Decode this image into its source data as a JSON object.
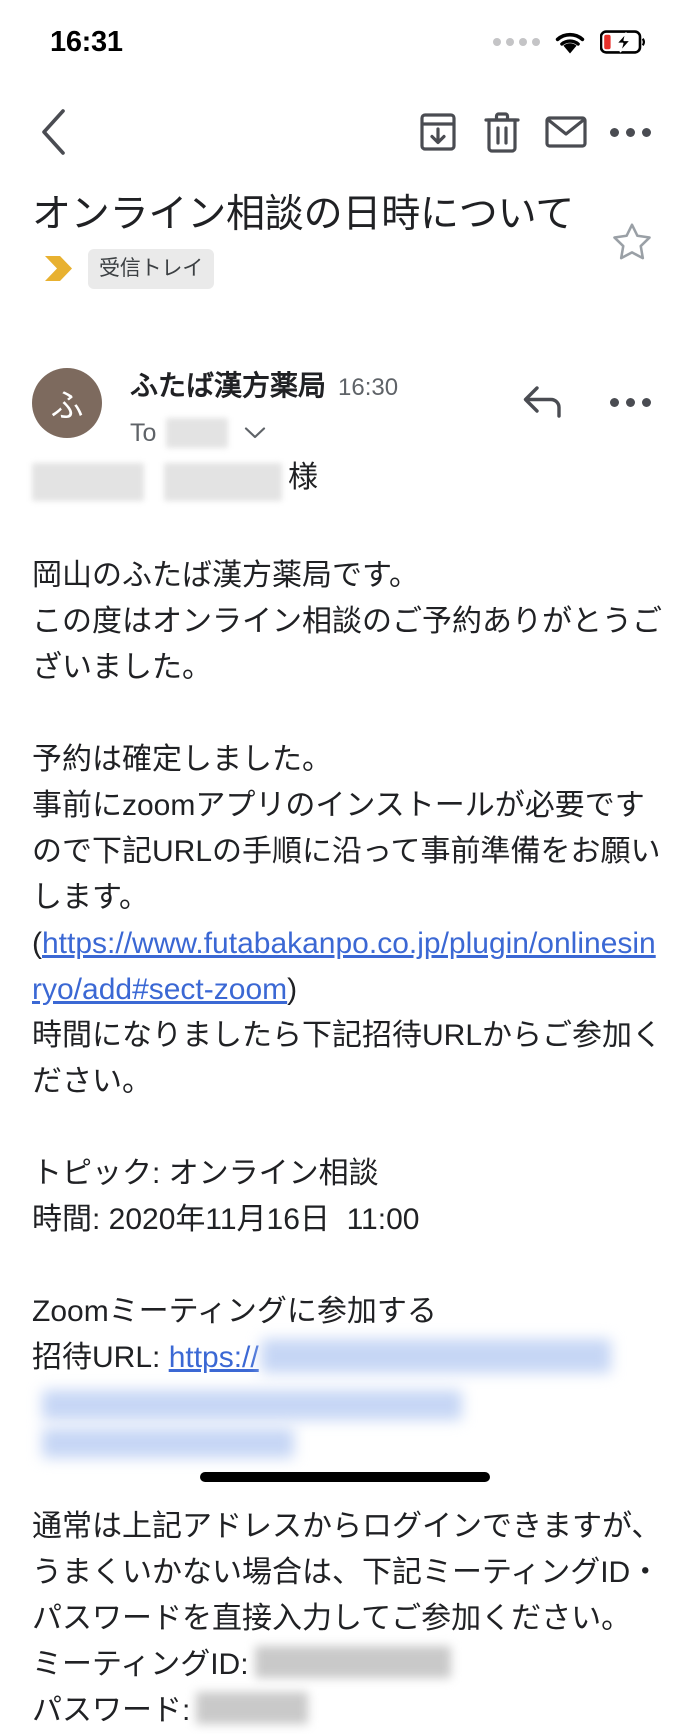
{
  "status_bar": {
    "time": "16:31",
    "signal_icon": "signal-dots-icon",
    "wifi_icon": "wifi-icon",
    "battery_icon": "battery-charging-low-icon",
    "battery_level_color": "#e8302a"
  },
  "action_bar": {
    "back_icon": "back-chevron-icon",
    "archive_icon": "archive-icon",
    "delete_icon": "trash-icon",
    "mark_unread_icon": "envelope-icon",
    "overflow_icon": "more-vertical-dots-icon"
  },
  "subject": {
    "text": "オンライン相談の日時について",
    "important_marker_icon": "important-chevron-icon",
    "important_marker_color": "#e8b130",
    "label_chip": "受信トレイ",
    "star_icon": "star-outline-icon",
    "star_color": "#9aa0a6"
  },
  "message": {
    "avatar_initial": "ふ",
    "avatar_color": "#7d6a5e",
    "sender_name": "ふたば漢方薬局",
    "time": "16:30",
    "to_label": "To",
    "to_value_redacted": true,
    "expand_icon": "chevron-down-icon",
    "reply_icon": "reply-arrow-icon",
    "overflow_icon": "more-horizontal-dots-icon"
  },
  "body": {
    "salutation_suffix": "様",
    "paragraph_1": "岡山のふたば漢方薬局です。\nこの度はオンライン相談のご予約ありがとうございました。",
    "paragraph_2_line1": "予約は確定しました。",
    "paragraph_2_line2": "事前にzoomアプリのインストールが必要ですので下記URLの手順に沿って事前準備をお願いします。",
    "url_open_paren": "(",
    "url_text": "https://www.futabakanpo.co.jp/plugin/onlinesinryo/add#sect-zoom",
    "url_close_paren": ")",
    "paragraph_2_line3": "時間になりましたら下記招待URLからご参加ください。",
    "topic_line": "トピック: オンライン相談",
    "time_line": "時間: 2020年11月16日  11:00",
    "join_line": "Zoomミーティングに参加する",
    "invite_url_label": "招待URL: ",
    "invite_url_visible": "https://",
    "invite_url_redacted": true,
    "paragraph_3": "通常は上記アドレスからログインできますが、うまくいかない場合は、下記ミーティングID・パスワードを直接入力してご参加ください。",
    "meeting_id_label": "ミーティングID:",
    "meeting_id_redacted": true,
    "password_label": "パスワード:",
    "password_redacted": true
  },
  "colors": {
    "link": "#3b68d4",
    "text": "#202124",
    "muted": "#5f6368",
    "chip_bg": "#eaeaea"
  }
}
